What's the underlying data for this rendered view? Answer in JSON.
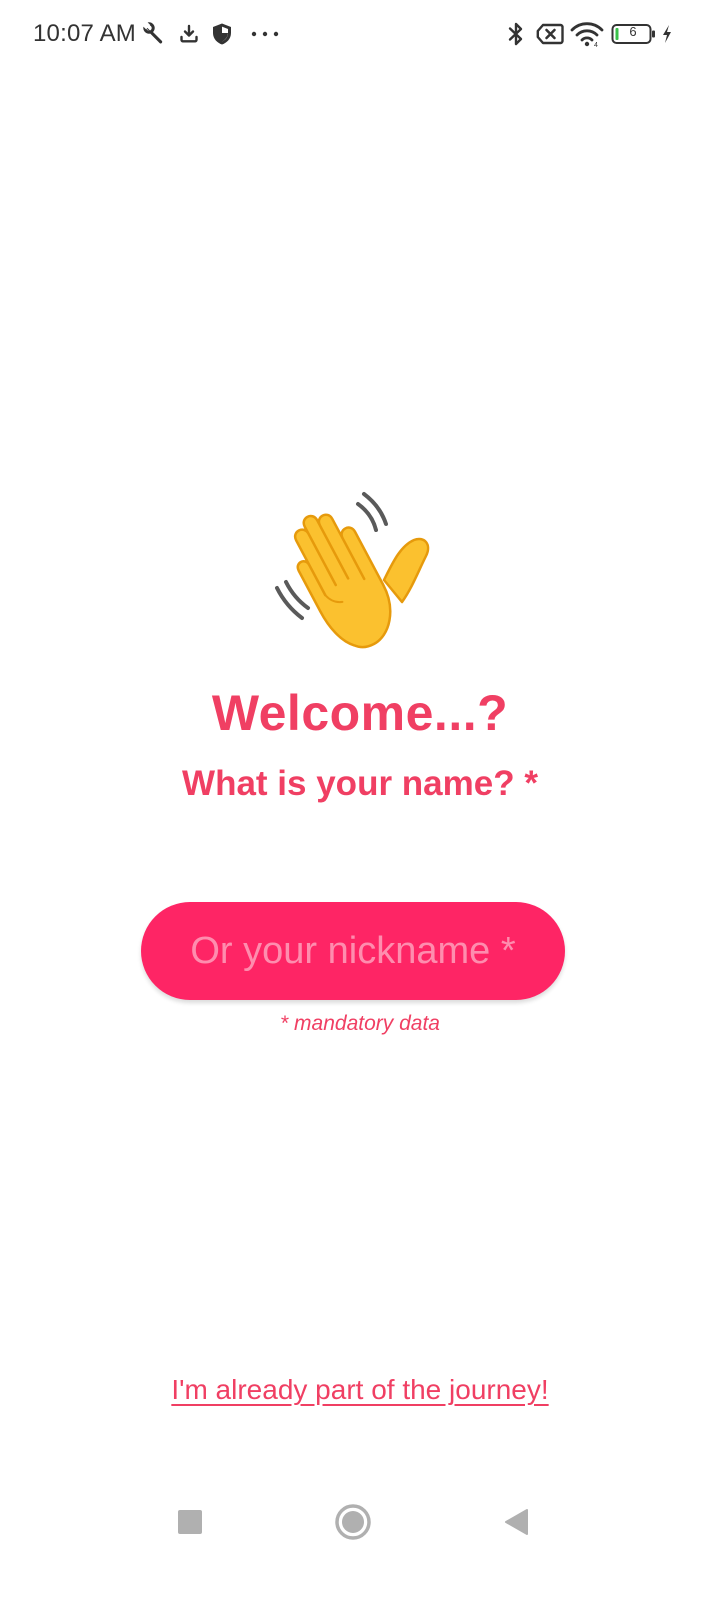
{
  "status_bar": {
    "time": "10:07 AM",
    "battery_level": "6",
    "icons": [
      "wrench-icon",
      "download-icon",
      "shield-icon",
      "more-dots-icon",
      "bluetooth-icon",
      "no-sim-icon",
      "wifi-icon",
      "battery-icon",
      "charging-icon"
    ]
  },
  "welcome": {
    "emoji": "waving-hand-icon",
    "title": "Welcome...?",
    "subtitle": "What is your name? *"
  },
  "name_field": {
    "value": "",
    "placeholder": "Or your nickname *"
  },
  "mandatory_note": "* mandatory data",
  "login_link": "I'm already part of the journey!",
  "navigation_bar": {
    "buttons": [
      "recents-square-icon",
      "home-circle-icon",
      "back-triangle-icon"
    ]
  },
  "colors": {
    "accent_text": "#f03f63",
    "input_background": "#fe2565",
    "background": "#ffffff"
  }
}
